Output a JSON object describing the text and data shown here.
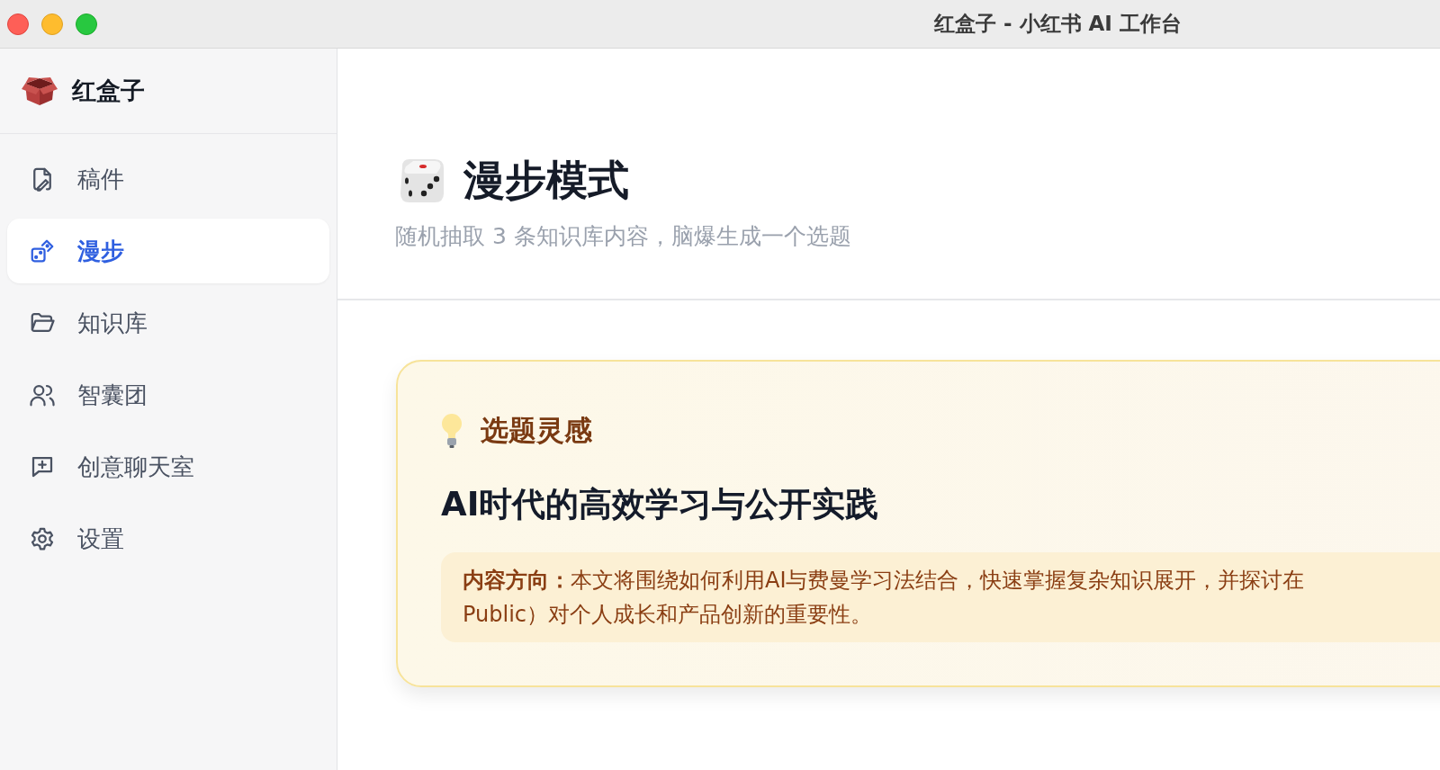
{
  "window": {
    "title": "红盒子 - 小红书 AI 工作台"
  },
  "sidebar": {
    "brand": "红盒子",
    "items": [
      {
        "label": "稿件",
        "kind": "drafts",
        "selected": false
      },
      {
        "label": "漫步",
        "kind": "dice",
        "selected": true
      },
      {
        "label": "知识库",
        "kind": "folder",
        "selected": false
      },
      {
        "label": "智囊团",
        "kind": "people",
        "selected": false
      },
      {
        "label": "创意聊天室",
        "kind": "chat",
        "selected": false
      },
      {
        "label": "设置",
        "kind": "settings",
        "selected": false
      }
    ]
  },
  "header": {
    "title": "漫步模式",
    "subtitle": "随机抽取 3 条知识库内容，脑爆生成一个选题"
  },
  "card": {
    "heading": "选题灵感",
    "title": "AI时代的高效学习与公开实践",
    "lines": [
      "**内容方向：**本文将围绕如何利用AI与费曼学习法结合，快速掌握复杂知识展开，并探讨在",
      "Public）对个人成长和产品创新的重要性。"
    ]
  }
}
